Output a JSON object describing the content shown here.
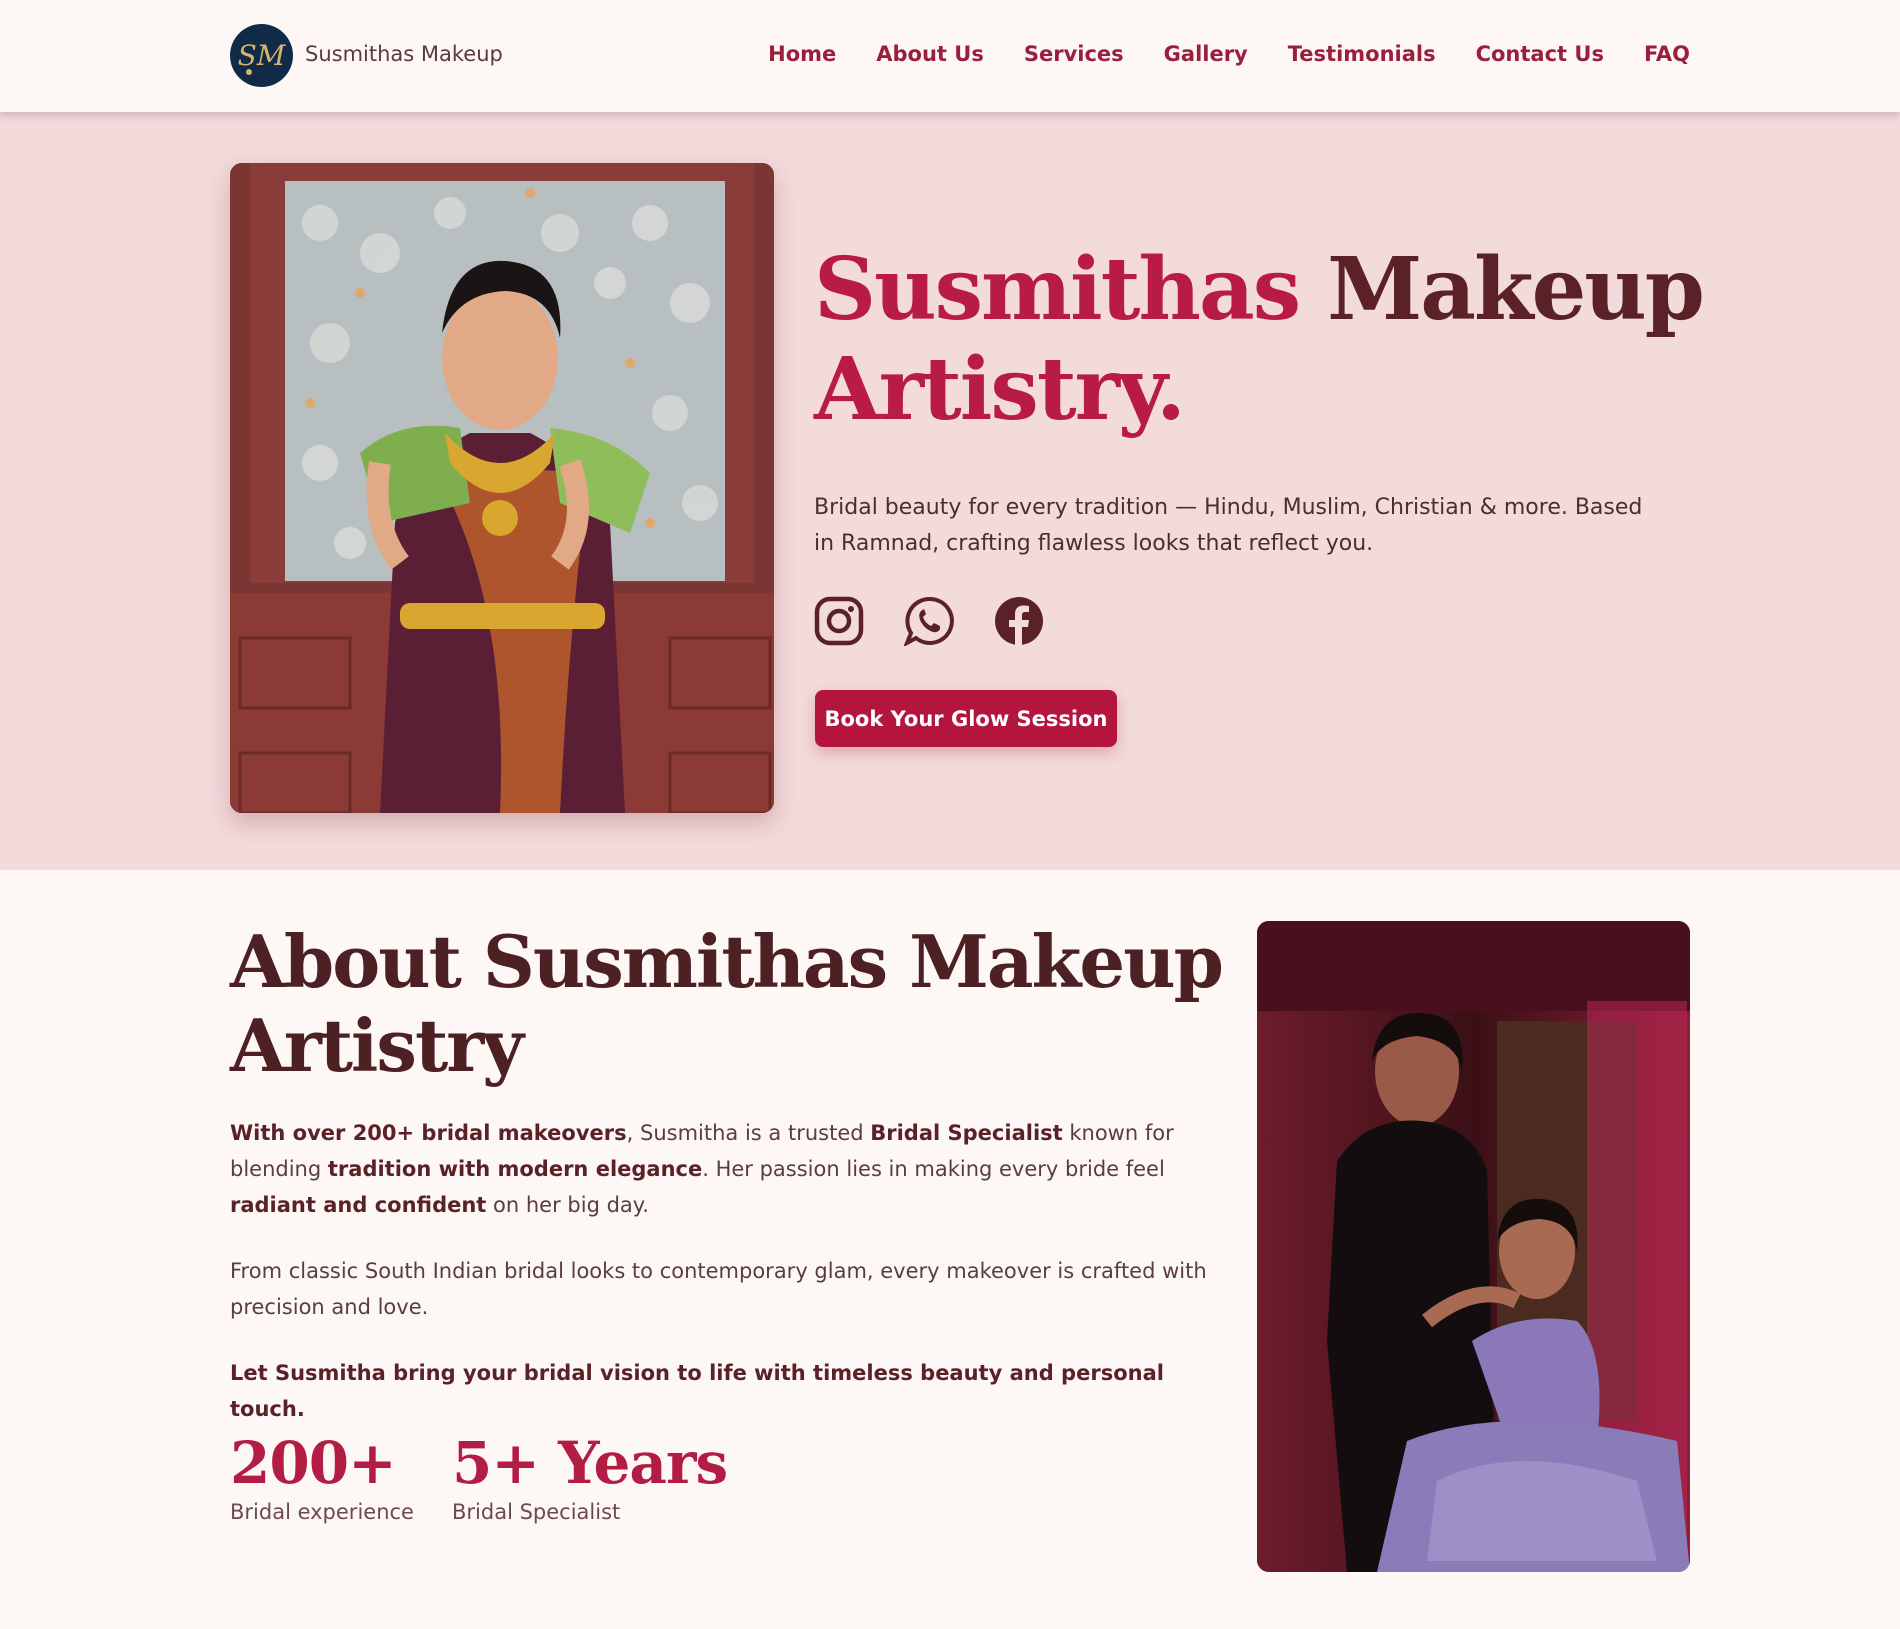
{
  "header": {
    "logo_monogram": "SM",
    "brand": "Susmithas Makeup",
    "nav": [
      "Home",
      "About Us",
      "Services",
      "Gallery",
      "Testimonials",
      "Contact Us",
      "FAQ"
    ]
  },
  "hero": {
    "title_part1": "Susmithas",
    "title_part2": "Makeup",
    "title_line2": "Artistry.",
    "subtitle": "Bridal beauty for every tradition — Hindu, Muslim, Christian & more. Based in Ramnad, crafting flawless looks that reflect you.",
    "socials": [
      "instagram-icon",
      "whatsapp-icon",
      "facebook-icon"
    ],
    "cta": "Book Your Glow Session"
  },
  "about": {
    "title": "About Susmithas Makeup Artistry",
    "p1": {
      "b1": "With over 200+ bridal makeovers",
      "t1": ", Susmitha is a trusted ",
      "b2": "Bridal Specialist",
      "t2": " known for blending ",
      "b3": "tradition with modern elegance",
      "t3": ". Her passion lies in making every bride feel ",
      "b4": "radiant and confident",
      "t4": " on her big day."
    },
    "p2": "From classic South Indian bridal looks to contemporary glam, every makeover is crafted with precision and love.",
    "p3": "Let Susmitha bring your bridal vision to life with timeless beauty and personal touch.",
    "stats": [
      {
        "value": "200+",
        "label": "Bridal experience"
      },
      {
        "value": "5+ Years",
        "label": "Bridal Specialist"
      }
    ]
  },
  "colors": {
    "accent": "#b81c45",
    "heading_dark": "#5a2226",
    "hero_bg": "#f3dadb",
    "page_bg": "#fdf8f6",
    "logo_bg": "#102a48"
  }
}
